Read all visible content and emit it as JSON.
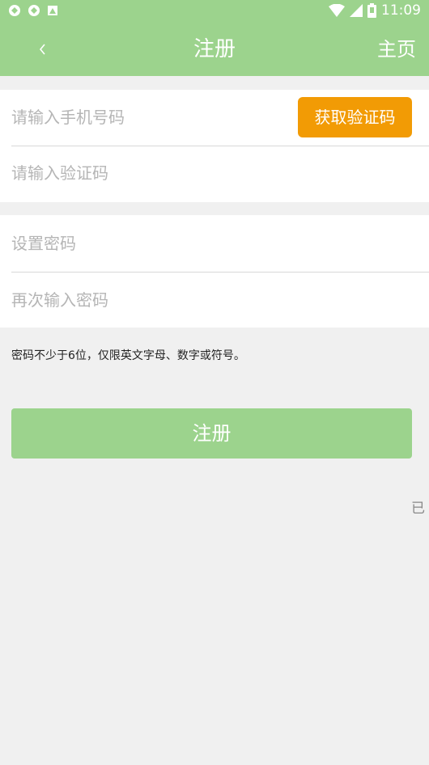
{
  "status_bar": {
    "time": "11:09",
    "icons": [
      "app-notification-icon",
      "app-notification-icon",
      "image-notification-icon",
      "wifi-icon",
      "signal-icon",
      "battery-icon"
    ]
  },
  "nav": {
    "back_icon": "chevron-left-icon",
    "title": "注册",
    "home_label": "主页"
  },
  "form": {
    "phone_placeholder": "请输入手机号码",
    "get_code_label": "获取验证码",
    "code_placeholder": "请输入验证码",
    "password_placeholder": "设置密码",
    "confirm_placeholder": "再次输入密码",
    "hint": "密码不少于6位，仅限英文字母、数字或符号。",
    "submit_label": "注册",
    "login_link": "已"
  },
  "colors": {
    "accent": "#9cd38d",
    "button_orange": "#f29b05",
    "background": "#f0f0f0"
  }
}
